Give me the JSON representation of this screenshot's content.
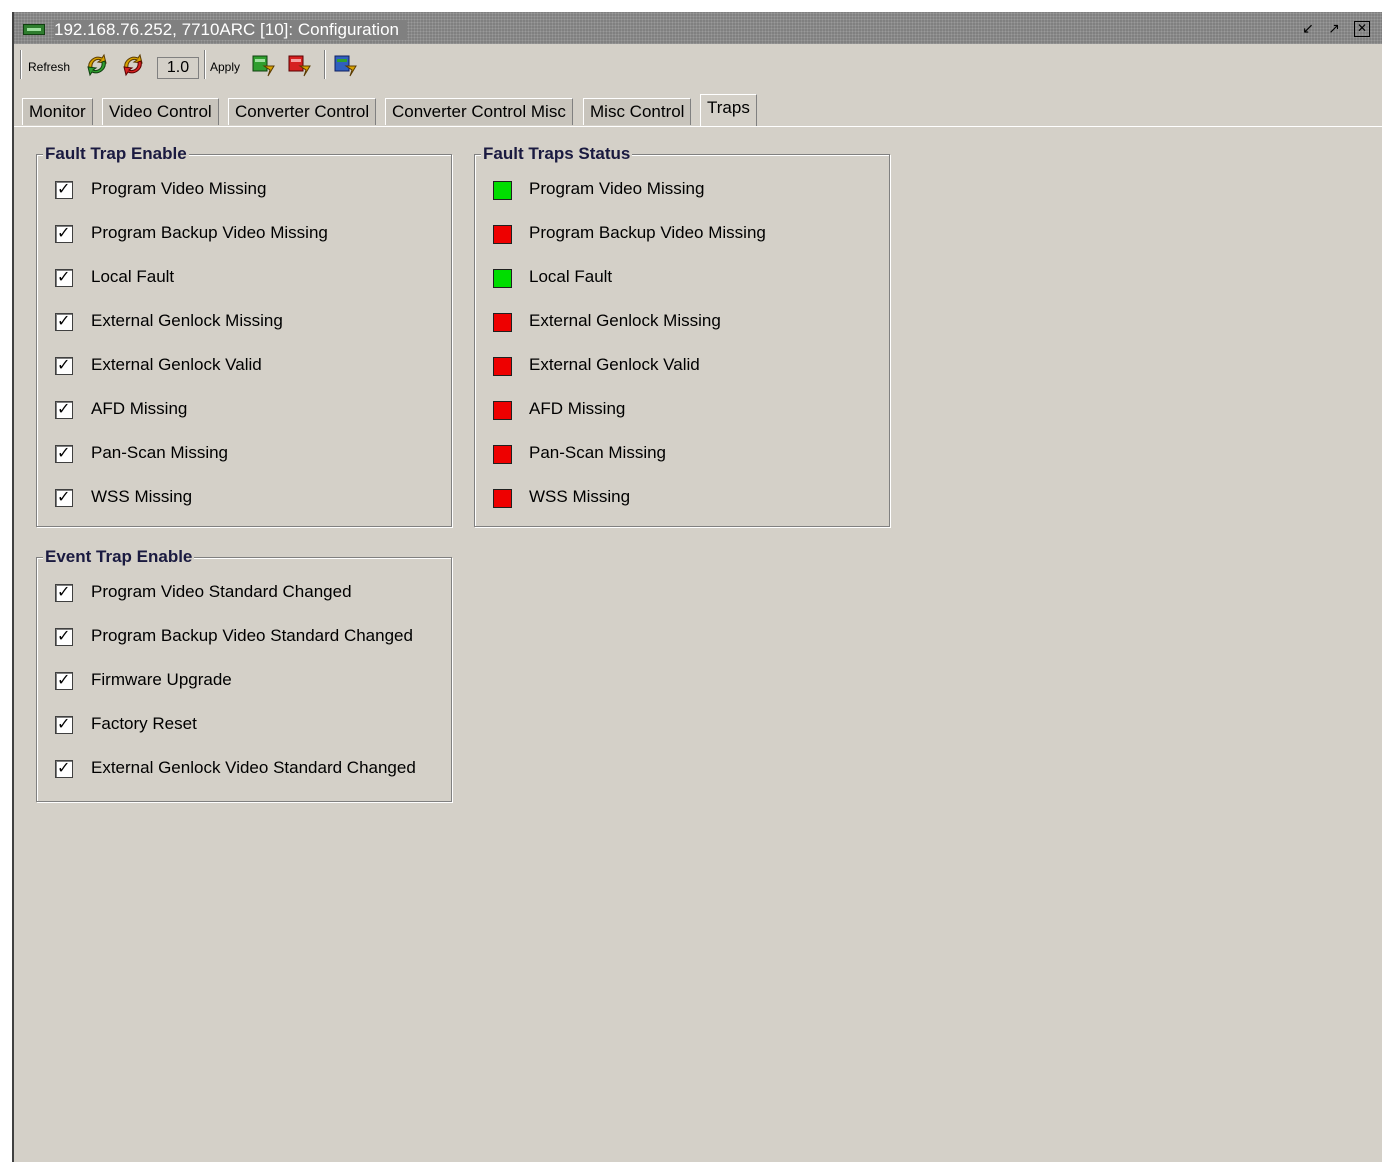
{
  "window": {
    "title": "192.168.76.252, 7710ARC  [10]: Configuration",
    "controls": [
      "restore-icon",
      "maximize-icon",
      "close-icon"
    ]
  },
  "toolbar": {
    "refresh_label": "Refresh",
    "version_value": "1.0",
    "apply_label": "Apply",
    "icons": [
      "refresh-green-icon",
      "refresh-red-icon",
      "apply-green-icon",
      "apply-red-icon",
      "apply-blue-icon"
    ]
  },
  "tabs": [
    {
      "label": "Monitor",
      "active": false
    },
    {
      "label": "Video Control",
      "active": false
    },
    {
      "label": "Converter Control",
      "active": false
    },
    {
      "label": "Converter Control Misc",
      "active": false
    },
    {
      "label": "Misc Control",
      "active": false
    },
    {
      "label": "Traps",
      "active": true
    }
  ],
  "fault_trap_enable": {
    "title": "Fault Trap Enable",
    "items": [
      {
        "label": "Program Video Missing",
        "checked": true
      },
      {
        "label": "Program Backup Video Missing",
        "checked": true
      },
      {
        "label": "Local Fault",
        "checked": true
      },
      {
        "label": "External Genlock Missing",
        "checked": true
      },
      {
        "label": "External Genlock Valid",
        "checked": true
      },
      {
        "label": "AFD Missing",
        "checked": true
      },
      {
        "label": "Pan-Scan Missing",
        "checked": true
      },
      {
        "label": "WSS Missing",
        "checked": true
      }
    ]
  },
  "fault_traps_status": {
    "title": "Fault Traps Status",
    "colors": {
      "ok": "#00dd00",
      "fault": "#ee0000"
    },
    "items": [
      {
        "label": "Program Video Missing",
        "status": "ok"
      },
      {
        "label": "Program Backup Video Missing",
        "status": "fault"
      },
      {
        "label": "Local Fault",
        "status": "ok"
      },
      {
        "label": "External Genlock Missing",
        "status": "fault"
      },
      {
        "label": "External Genlock Valid",
        "status": "fault"
      },
      {
        "label": "AFD Missing",
        "status": "fault"
      },
      {
        "label": "Pan-Scan Missing",
        "status": "fault"
      },
      {
        "label": "WSS Missing",
        "status": "fault"
      }
    ]
  },
  "event_trap_enable": {
    "title": "Event Trap Enable",
    "items": [
      {
        "label": "Program Video Standard Changed",
        "checked": true
      },
      {
        "label": "Program Backup Video Standard Changed",
        "checked": true
      },
      {
        "label": "Firmware Upgrade",
        "checked": true
      },
      {
        "label": "Factory Reset",
        "checked": true
      },
      {
        "label": "External Genlock Video Standard Changed",
        "checked": true
      }
    ]
  }
}
